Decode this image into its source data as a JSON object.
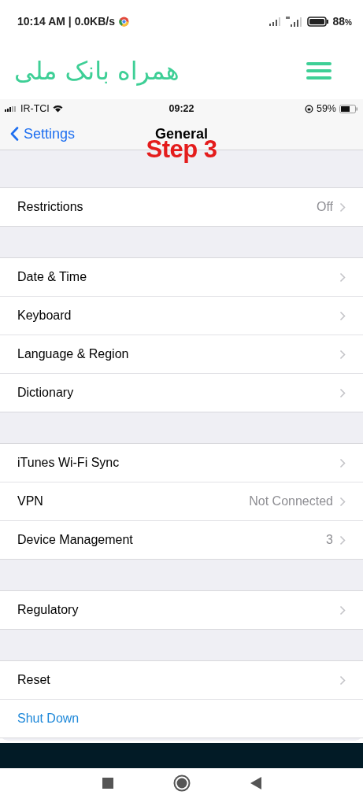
{
  "android_status": {
    "time": "10:14 AM | 0.0KB/s",
    "battery": "88",
    "battery_unit": "%"
  },
  "app_header": {
    "title": "همراه بانک ملی"
  },
  "ios_status": {
    "carrier": "IR-TCI",
    "time": "09:22",
    "battery": "59%"
  },
  "nav": {
    "back": "Settings",
    "title": "General",
    "annotation": "Step 3"
  },
  "groups": [
    {
      "rows": [
        {
          "label": "Restrictions",
          "value": "Off",
          "kind": "item"
        }
      ]
    },
    {
      "rows": [
        {
          "label": "Date & Time",
          "kind": "item"
        },
        {
          "label": "Keyboard",
          "kind": "item"
        },
        {
          "label": "Language & Region",
          "kind": "item"
        },
        {
          "label": "Dictionary",
          "kind": "item"
        }
      ]
    },
    {
      "rows": [
        {
          "label": "iTunes Wi-Fi Sync",
          "kind": "item"
        },
        {
          "label": "VPN",
          "value": "Not Connected",
          "kind": "item"
        },
        {
          "label": "Device Management",
          "value": "3",
          "kind": "item"
        }
      ]
    },
    {
      "rows": [
        {
          "label": "Regulatory",
          "kind": "item"
        }
      ]
    },
    {
      "rows": [
        {
          "label": "Reset",
          "kind": "item"
        },
        {
          "label": "Shut Down",
          "kind": "link"
        }
      ]
    }
  ]
}
